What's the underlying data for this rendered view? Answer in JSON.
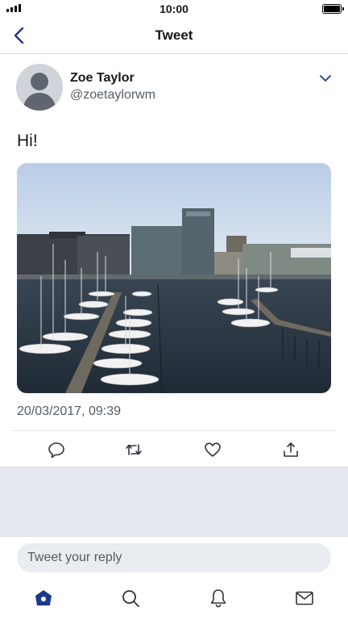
{
  "status_bar": {
    "time": "10:00",
    "signal_icon": "signal-icon",
    "battery_icon": "battery-icon"
  },
  "nav": {
    "title": "Tweet",
    "back_icon": "chevron-left-icon"
  },
  "tweet": {
    "author_name": "Zoe Taylor",
    "author_handle": "@zoetaylorwm",
    "text": "Hi!",
    "timestamp": "20/03/2017, 09:39",
    "menu_icon": "chevron-down-icon"
  },
  "actions": [
    "reply-icon",
    "retweet-icon",
    "like-icon",
    "share-icon"
  ],
  "reply": {
    "placeholder": "Tweet your reply"
  },
  "tab_bar": [
    "home-icon",
    "search-icon",
    "notifications-icon",
    "messages-icon"
  ],
  "colors": {
    "accent": "#1d3a8a",
    "icon": "#2f3338",
    "secondary_text": "#555c63",
    "divider_bg": "#e6e9ef"
  }
}
